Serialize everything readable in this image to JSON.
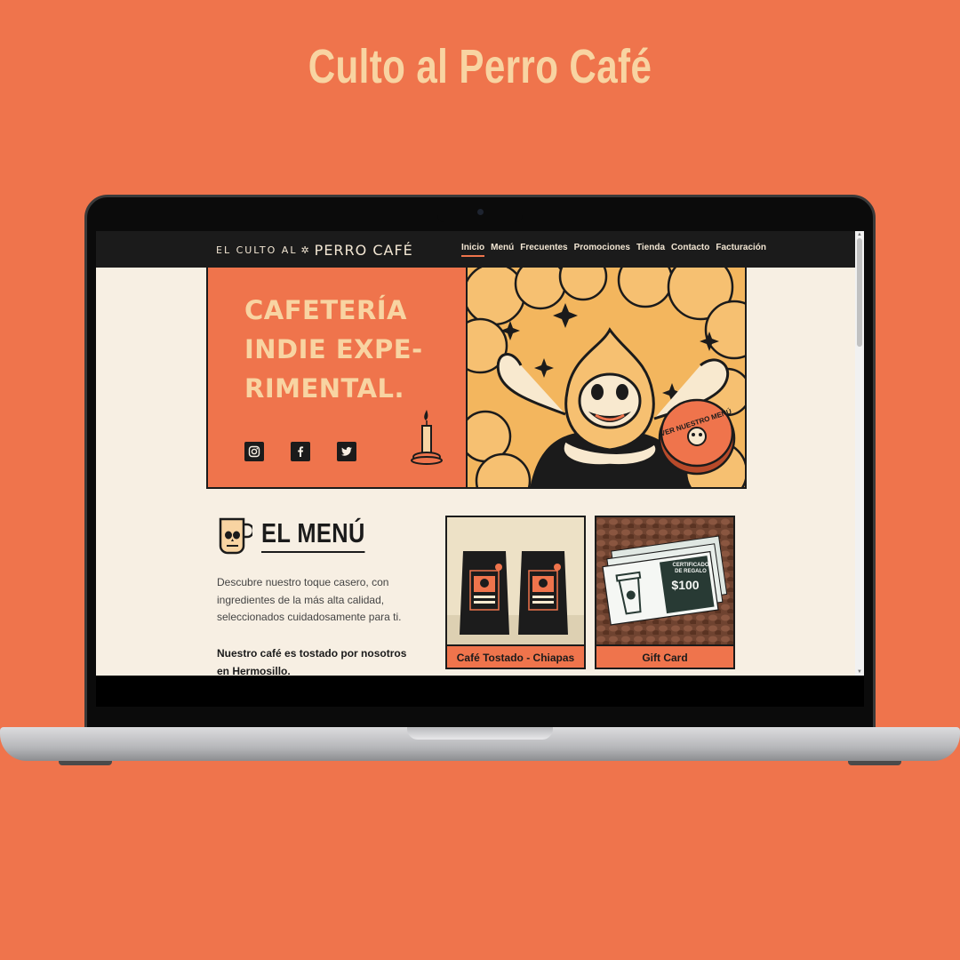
{
  "title": "Culto al Perro Café",
  "site": {
    "logo_small": "EL CULTO AL",
    "logo_big": "PERRO CAFÉ",
    "nav": [
      "Inicio",
      "Menú",
      "Frecuentes",
      "Promociones",
      "Tienda",
      "Contacto",
      "Facturación"
    ],
    "active_nav": "Inicio"
  },
  "hero": {
    "line1": "CAFETERÍA",
    "line2": "INDIE EXPE-",
    "line3": "RIMENTAL.",
    "badge": "VER NUESTRO MENÚ",
    "socials": [
      "instagram-icon",
      "facebook-icon",
      "twitter-icon"
    ]
  },
  "menu": {
    "title": "EL MENÚ",
    "description": "Descubre nuestro toque casero, con ingredientes de la más alta calidad, seleccionados cuidadosamente para ti.",
    "bold": "Nuestro café es tostado por nosotros en Hermosillo.",
    "cards": [
      {
        "label": "Café Tostado - Chiapas"
      },
      {
        "label": "Gift Card",
        "cert_line1": "CERTIFICADO",
        "cert_line2": "DE REGALO",
        "amount": "$100"
      }
    ]
  },
  "colors": {
    "background": "#ef744c",
    "cream": "#f8d4a2",
    "dark": "#1b1b1b",
    "paper": "#f7efe3",
    "mustard": "#f3b65e"
  }
}
